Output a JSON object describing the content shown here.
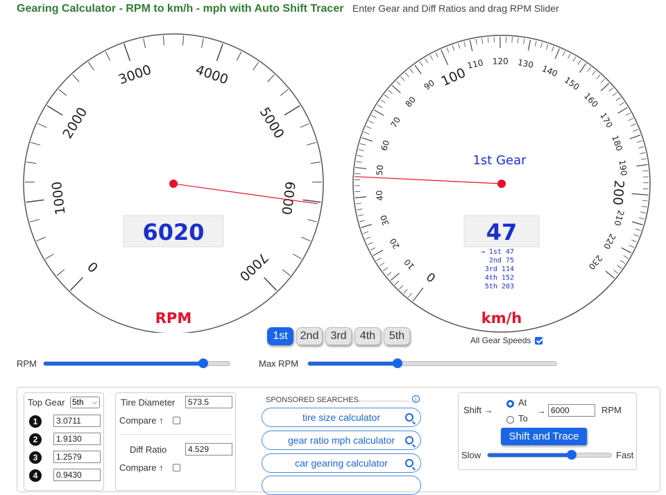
{
  "header": {
    "title": "Gearing Calculator - RPM to km/h - mph with Auto Shift Tracer",
    "subtitle": "Enter Gear and Diff Ratios and drag RPM Slider"
  },
  "tacho": {
    "labels": [
      "0",
      "1000",
      "2000",
      "3000",
      "4000",
      "5000",
      "6000",
      "7000"
    ],
    "value": 6020,
    "readout": "6020",
    "unit": "RPM",
    "max": 7000
  },
  "speedo": {
    "major_labels": [
      "100",
      "200"
    ],
    "minor_labels": [
      "0",
      "10",
      "20",
      "30",
      "40",
      "50",
      "60",
      "70",
      "80",
      "90",
      "110",
      "120",
      "130",
      "140",
      "150",
      "160",
      "170",
      "180",
      "190",
      "210",
      "220",
      "230"
    ],
    "value": 47,
    "readout": "47",
    "unit": "km/h",
    "max": 230,
    "gear_label": "1st Gear",
    "gear_speeds": [
      {
        "text": "→ 1st  47"
      },
      {
        "text": "2nd  75"
      },
      {
        "text": "3rd  114"
      },
      {
        "text": "4th  152"
      },
      {
        "text": "5th  203"
      }
    ]
  },
  "gear_tabs": [
    "1st",
    "2nd",
    "3rd",
    "4th",
    "5th"
  ],
  "active_gear": 0,
  "all_gear_speeds_label": "All Gear Speeds",
  "all_gear_speeds_checked": true,
  "rpm_slider": {
    "label": "RPM",
    "value_fraction": 0.86
  },
  "max_rpm_slider": {
    "label": "Max RPM",
    "value_fraction": 0.36
  },
  "gears_panel": {
    "top_gear_label": "Top Gear",
    "top_gear_value": "5th",
    "ratios": [
      {
        "num": "1",
        "value": "3.0711"
      },
      {
        "num": "2",
        "value": "1.9130"
      },
      {
        "num": "3",
        "value": "1.2579"
      },
      {
        "num": "4",
        "value": "0.9430"
      }
    ]
  },
  "tire_panel": {
    "tire_label": "Tire Diameter",
    "tire_value": "573.5",
    "compare_label": "Compare ↑",
    "diff_label": "Diff Ratio",
    "diff_value": "4.529",
    "compare2_label": "Compare ↑"
  },
  "sponsored": {
    "title": "SPONSORED SEARCHES",
    "info": "i",
    "items": [
      "tire size calculator",
      "gear ratio mph calculator",
      "car gearing calculator"
    ]
  },
  "shift": {
    "label": "Shift →",
    "at_label": "At",
    "to_label": "To",
    "arrow": "→",
    "rpm_value": "6000",
    "rpm_unit": "RPM",
    "button": "Shift and Trace",
    "slow_label": "Slow",
    "fast_label": "Fast",
    "speed_fraction": 0.68
  },
  "colors": {
    "accent": "#1a66e8",
    "needle": "#e8102a",
    "unit_red": "#e8102a",
    "readout_blue": "#1a2fcc",
    "title_green": "#2e7d32"
  }
}
